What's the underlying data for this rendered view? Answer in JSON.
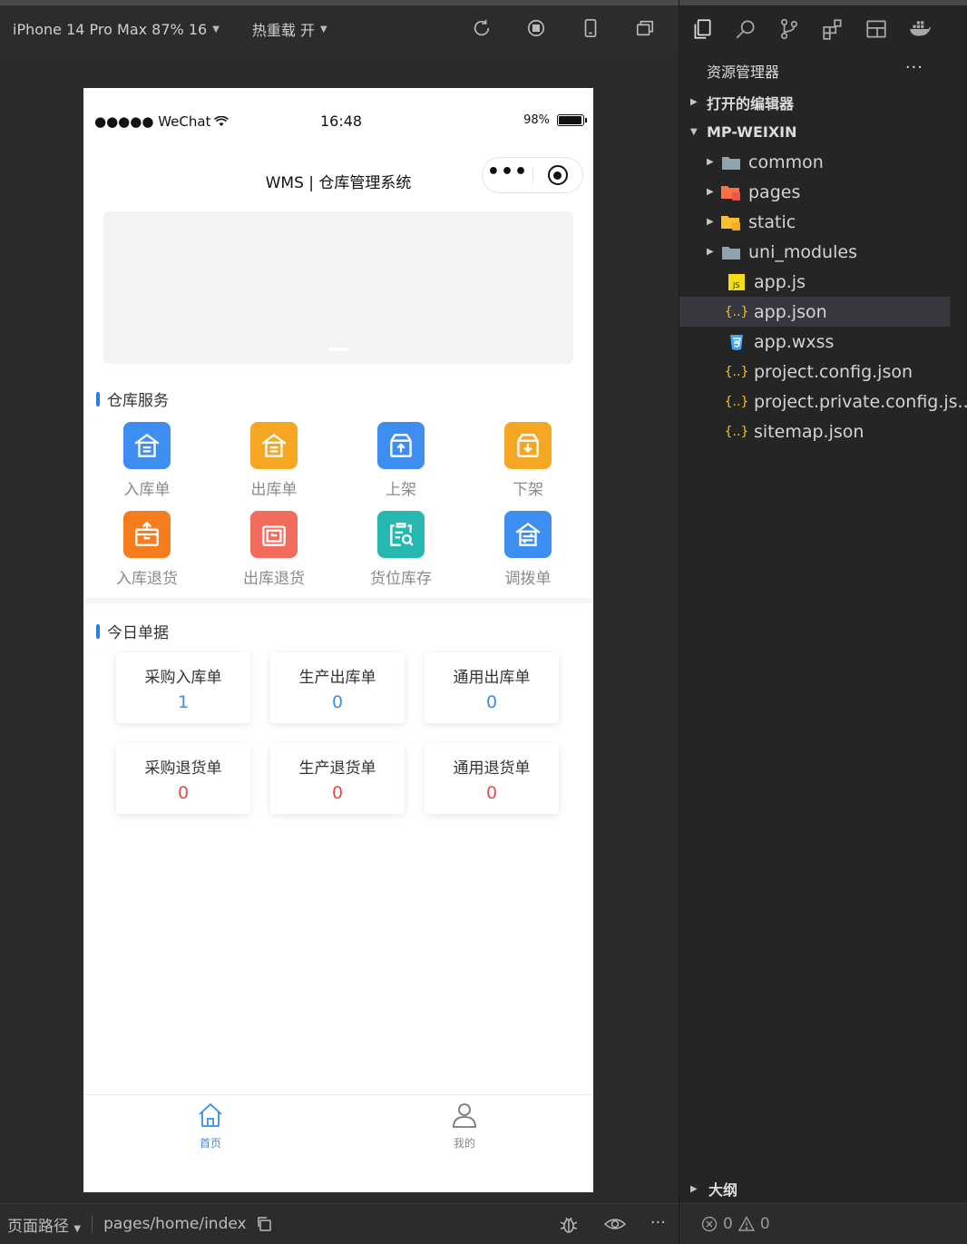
{
  "toolbar": {
    "device": "iPhone 14 Pro Max 87% 16",
    "hot_reload": "热重载 开"
  },
  "phone": {
    "status": {
      "carrier": "●●●●● WeChat",
      "time": "16:48",
      "battery": "98%"
    },
    "nav_title": "WMS | 仓库管理系统",
    "services_title": "仓库服务",
    "services": [
      {
        "label": "入库单",
        "color": "#3d8ef0",
        "icon": "inbound-icon"
      },
      {
        "label": "出库单",
        "color": "#f5a623",
        "icon": "outbound-icon"
      },
      {
        "label": "上架",
        "color": "#3d8ef0",
        "icon": "shelve-up-icon"
      },
      {
        "label": "下架",
        "color": "#f5a623",
        "icon": "shelve-down-icon"
      },
      {
        "label": "入库退货",
        "color": "#f57c1f",
        "icon": "inbound-return-icon"
      },
      {
        "label": "出库退货",
        "color": "#f26b5b",
        "icon": "outbound-return-icon"
      },
      {
        "label": "货位库存",
        "color": "#26b8b0",
        "icon": "location-stock-icon"
      },
      {
        "label": "调拨单",
        "color": "#3d8ef0",
        "icon": "transfer-icon"
      }
    ],
    "today_title": "今日单据",
    "cards": [
      {
        "title": "采购入库单",
        "value": "1",
        "tone": "blue"
      },
      {
        "title": "生产出库单",
        "value": "0",
        "tone": "blue"
      },
      {
        "title": "通用出库单",
        "value": "0",
        "tone": "blue"
      },
      {
        "title": "采购退货单",
        "value": "0",
        "tone": "red"
      },
      {
        "title": "生产退货单",
        "value": "0",
        "tone": "red"
      },
      {
        "title": "通用退货单",
        "value": "0",
        "tone": "red"
      }
    ],
    "tabs": [
      {
        "label": "首页",
        "active": true
      },
      {
        "label": "我的",
        "active": false
      }
    ]
  },
  "bottom": {
    "path_label": "页面路径",
    "path": "pages/home/index"
  },
  "explorer": {
    "title": "资源管理器",
    "more": "···",
    "open_editors": "打开的编辑器",
    "project": "MP-WEIXIN",
    "items": [
      {
        "name": "common",
        "type": "folder"
      },
      {
        "name": "pages",
        "type": "folder-pages"
      },
      {
        "name": "static",
        "type": "folder-static"
      },
      {
        "name": "uni_modules",
        "type": "folder"
      },
      {
        "name": "app.js",
        "type": "js"
      },
      {
        "name": "app.json",
        "type": "json",
        "selected": true
      },
      {
        "name": "app.wxss",
        "type": "css"
      },
      {
        "name": "project.config.json",
        "type": "json"
      },
      {
        "name": "project.private.config.js...",
        "type": "json"
      },
      {
        "name": "sitemap.json",
        "type": "json"
      }
    ],
    "outline": "大纲",
    "errors": "0",
    "warnings": "0"
  }
}
